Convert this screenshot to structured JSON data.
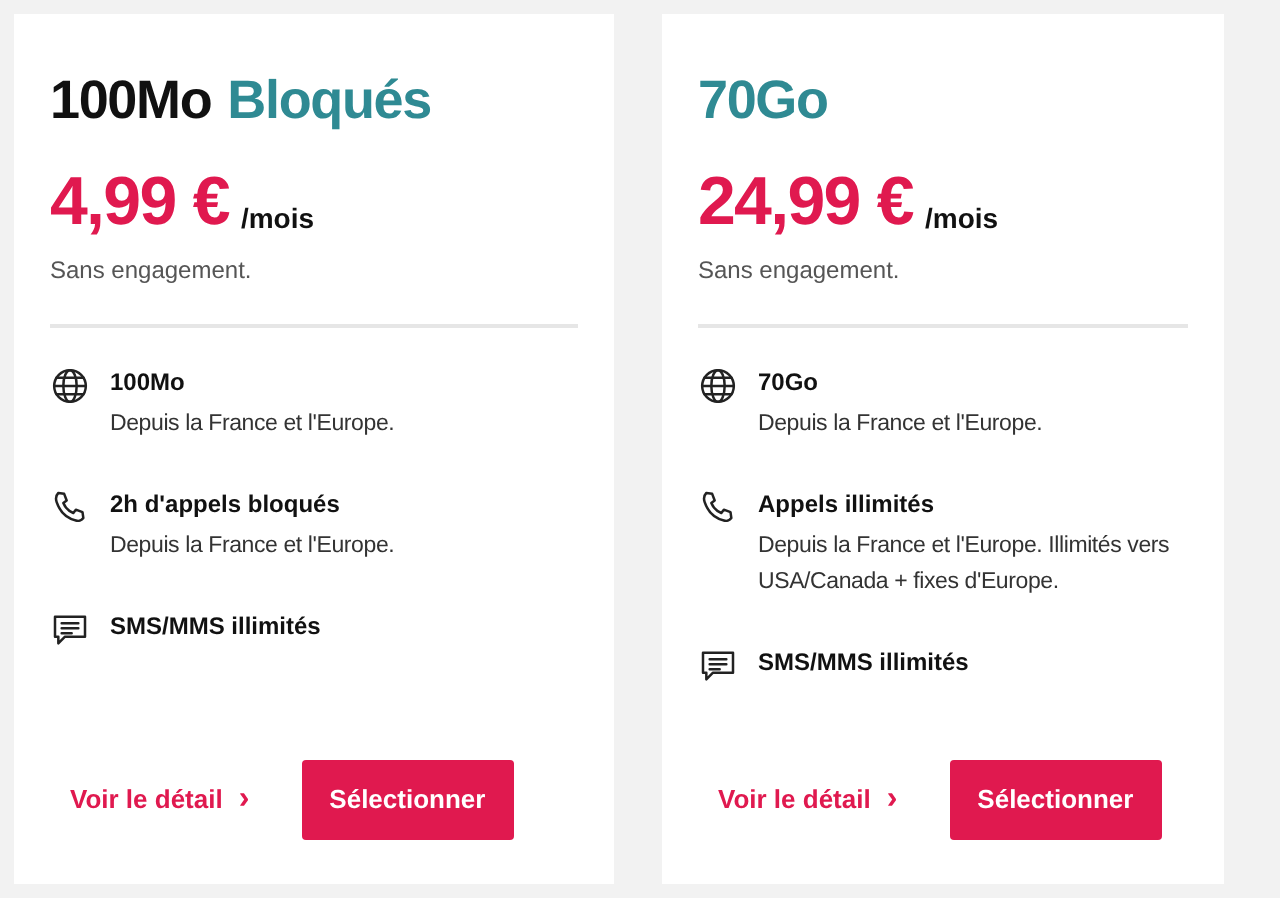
{
  "plans": [
    {
      "title": [
        {
          "text": "100Mo",
          "kind": "plain"
        },
        {
          "text": "Bloqués",
          "kind": "accent"
        }
      ],
      "price": "4,99 €",
      "period": "/mois",
      "commitment": "Sans engagement.",
      "features": [
        {
          "kind": "data",
          "title": "100Mo",
          "detail": "Depuis la France et l'Europe."
        },
        {
          "kind": "calls",
          "title": "2h d'appels bloqués",
          "detail": "Depuis la France et l'Europe."
        },
        {
          "kind": "messages",
          "title": "SMS/MMS illimités"
        }
      ],
      "detail_link": "Voir le détail",
      "detail_arrow": "›",
      "button": "Sélectionner"
    },
    {
      "title": [
        {
          "text": "70Go",
          "kind": "accent"
        }
      ],
      "price": "24,99 €",
      "period": "/mois",
      "commitment": "Sans engagement.",
      "features": [
        {
          "kind": "data",
          "title": "70Go",
          "detail": "Depuis la France et l'Europe."
        },
        {
          "kind": "calls",
          "title": "Appels illimités",
          "detail": "Depuis la France et l'Europe. Illimités vers USA/Canada + fixes d'Europe."
        },
        {
          "kind": "messages",
          "title": "SMS/MMS illimités"
        }
      ],
      "detail_link": "Voir le détail",
      "detail_arrow": "›",
      "button": "Sélectionner"
    }
  ]
}
